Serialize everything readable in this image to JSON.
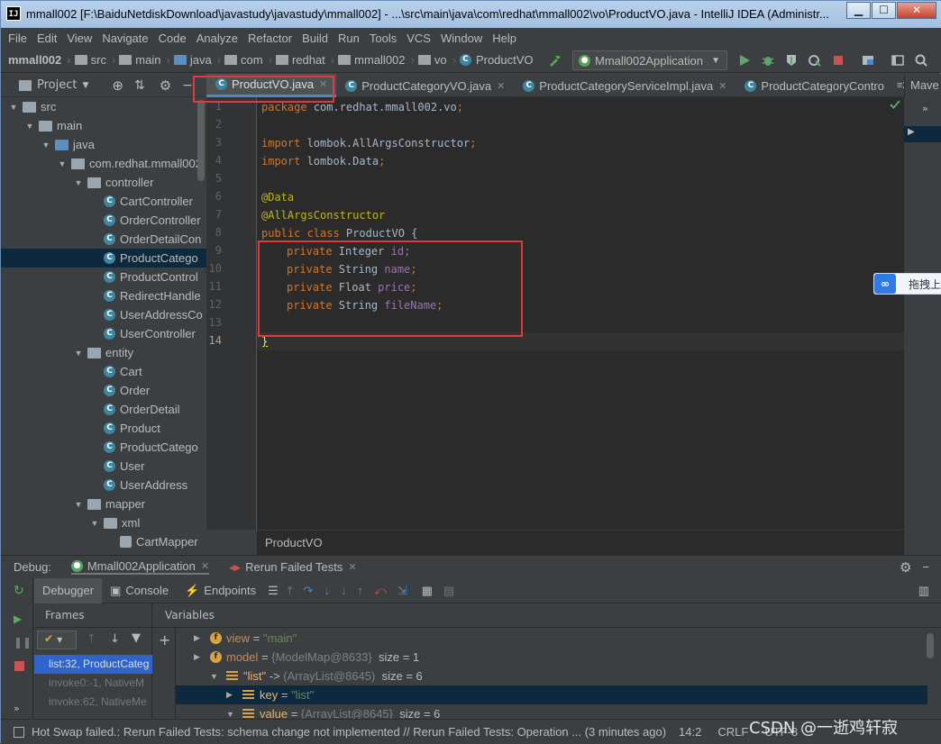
{
  "window": {
    "title": "mmall002 [F:\\BaiduNetdiskDownload\\javastudy\\javastudy\\mmall002] - ...\\src\\main\\java\\com\\redhat\\mmall002\\vo\\ProductVO.java - IntelliJ IDEA (Administr...",
    "app_icon": "IJ",
    "buttons": {
      "minimize": "▁",
      "maximize": "☐",
      "close": "✕"
    }
  },
  "menu": [
    "File",
    "Edit",
    "View",
    "Navigate",
    "Code",
    "Analyze",
    "Refactor",
    "Build",
    "Run",
    "Tools",
    "VCS",
    "Window",
    "Help"
  ],
  "breadcrumbs": [
    "mmall002",
    "src",
    "main",
    "java",
    "com",
    "redhat",
    "mmall002",
    "vo",
    "ProductVO"
  ],
  "run_config": "Mmall002Application",
  "project_panel": {
    "title": "Project"
  },
  "editor_tabs": [
    {
      "label": "ProductVO.java",
      "active": true
    },
    {
      "label": "ProductCategoryVO.java",
      "active": false
    },
    {
      "label": "ProductCategoryServiceImpl.java",
      "active": false
    },
    {
      "label": "ProductCategoryContro",
      "active": false
    }
  ],
  "tabs_overflow": "≡2",
  "maven_panel": "Mave",
  "tree": [
    {
      "label": "src",
      "arrow": "▼",
      "icon": "folder"
    },
    {
      "label": "main",
      "arrow": "▼",
      "icon": "folder"
    },
    {
      "label": "java",
      "arrow": "▼",
      "icon": "folder-blue"
    },
    {
      "label": "com.redhat.mmall002",
      "arrow": "▼",
      "icon": "folder"
    },
    {
      "label": "controller",
      "arrow": "▼",
      "icon": "folder"
    },
    {
      "label": "CartController",
      "icon": "class"
    },
    {
      "label": "OrderController",
      "icon": "class"
    },
    {
      "label": "OrderDetailCon",
      "icon": "class"
    },
    {
      "label": "ProductCatego",
      "icon": "class",
      "selected": true
    },
    {
      "label": "ProductControl",
      "icon": "class"
    },
    {
      "label": "RedirectHandle",
      "icon": "class"
    },
    {
      "label": "UserAddressCo",
      "icon": "class"
    },
    {
      "label": "UserController",
      "icon": "class"
    },
    {
      "label": "entity",
      "arrow": "▼",
      "icon": "folder"
    },
    {
      "label": "Cart",
      "icon": "class"
    },
    {
      "label": "Order",
      "icon": "class"
    },
    {
      "label": "OrderDetail",
      "icon": "class"
    },
    {
      "label": "Product",
      "icon": "class"
    },
    {
      "label": "ProductCatego",
      "icon": "class"
    },
    {
      "label": "User",
      "icon": "class"
    },
    {
      "label": "UserAddress",
      "icon": "class"
    },
    {
      "label": "mapper",
      "arrow": "▼",
      "icon": "folder"
    },
    {
      "label": "xml",
      "arrow": "▼",
      "icon": "folder"
    },
    {
      "label": "CartMapper",
      "icon": "xml"
    }
  ],
  "code": {
    "line_numbers": [
      "1",
      "2",
      "3",
      "4",
      "5",
      "6",
      "7",
      "8",
      "9",
      "10",
      "11",
      "12",
      "13",
      "14"
    ],
    "package_kw": "package",
    "package_name": " com.redhat.mmall002.vo",
    "import_kw": "import",
    "import1": " lombok.AllArgsConstructor",
    "import2": " lombok.Data",
    "anno1": "@Data",
    "anno2": "@AllArgsConstructor",
    "class_decl_kw": "public class",
    "class_name": " ProductVO {",
    "private_kw": "private",
    "fields": [
      {
        "type": " Integer ",
        "name": "id"
      },
      {
        "type": " String ",
        "name": "name"
      },
      {
        "type": " Float ",
        "name": "price"
      },
      {
        "type": " String ",
        "name": "fileName"
      }
    ],
    "semicolon": ";",
    "closing": "}"
  },
  "editor_breadcrumb": "ProductVO",
  "baidu_widget": {
    "icon": "∞",
    "text": "拖拽上"
  },
  "debug": {
    "label": "Debug:",
    "tabs": [
      {
        "label": "Mmall002Application",
        "active": true
      },
      {
        "label": "Rerun Failed Tests",
        "active": false
      }
    ],
    "toolbar_tabs": [
      "Debugger",
      "Console",
      "Endpoints"
    ],
    "frames_title": "Frames",
    "variables_title": "Variables",
    "frames": [
      {
        "label": "list:32, ProductCateg",
        "selected": true
      },
      {
        "label": "invoke0:-1, NativeM"
      },
      {
        "label": "invoke:62, NativeMe"
      }
    ],
    "variables": [
      {
        "arrow": "▶",
        "badge": "f",
        "name": "view",
        "eq": " = ",
        "value": "\"main\"",
        "kind": "str"
      },
      {
        "arrow": "▶",
        "badge": "f",
        "name": "model",
        "eq": " = ",
        "value": "{ModelMap@8633}",
        "extra": "  size = 1",
        "kind": "ref"
      },
      {
        "arrow": "▼",
        "badge": "list",
        "name": "\"list\"",
        "eq": " -> ",
        "value": "(ArrayList@8645)",
        "extra": "  size = 6",
        "kind": "ref",
        "indent": 1
      },
      {
        "arrow": "▶",
        "badge": "list",
        "name": "key",
        "eq": " = ",
        "value": "\"list\"",
        "kind": "str",
        "indent": 2,
        "selected": true
      },
      {
        "arrow": "▼",
        "badge": "list",
        "name": "value",
        "eq": " = ",
        "value": "{ArrayList@8645}",
        "extra": "  size = 6",
        "kind": "ref",
        "indent": 2
      }
    ]
  },
  "status": {
    "message": "Hot Swap failed.: Rerun Failed Tests: schema change not implemented // Rerun Failed Tests: Operation ... (3 minutes ago)",
    "position": "14:2",
    "line_sep": "CRLF",
    "encoding": "UTF-8"
  },
  "watermark": "CSDN @一逝鸡轩寂"
}
